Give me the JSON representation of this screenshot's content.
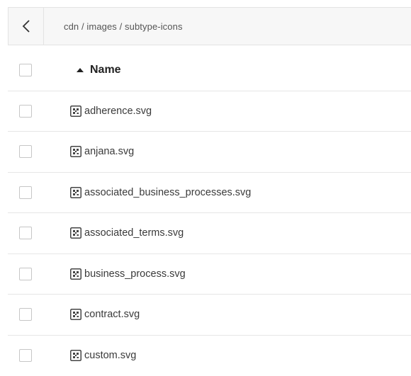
{
  "breadcrumb": "cdn / images / subtype-icons",
  "back_icon": "chevron-left-icon",
  "table": {
    "header": {
      "sort_icon": "sort-ascending-icon",
      "label": "Name"
    },
    "file_icon": "image-file-icon",
    "files": [
      "adherence.svg",
      "anjana.svg",
      "associated_business_processes.svg",
      "associated_terms.svg",
      "business_process.svg",
      "contract.svg",
      "custom.svg"
    ]
  }
}
